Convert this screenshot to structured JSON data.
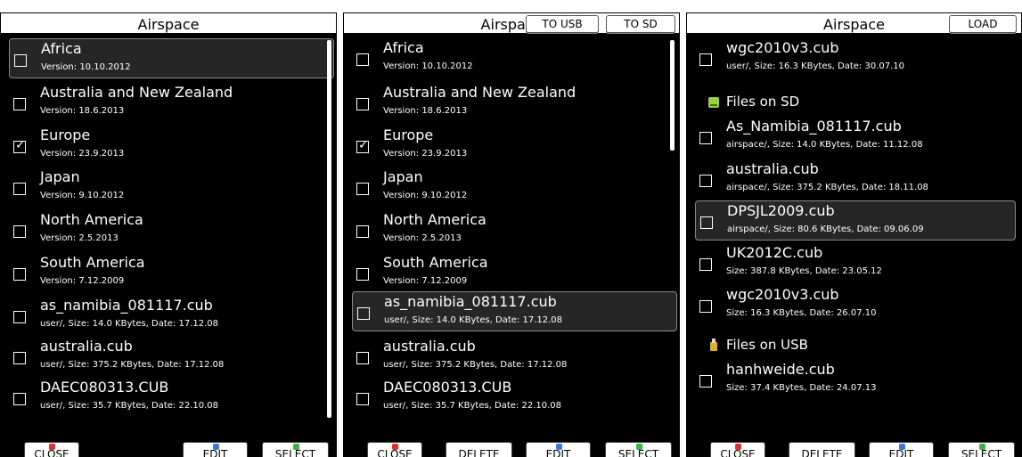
{
  "panels": [
    {
      "title": "Airspace",
      "rows": [
        {
          "name": "Africa",
          "meta": "Version: 10.10.2012",
          "checked": false
        },
        {
          "name": "Australia and New Zealand",
          "meta": "Version: 18.6.2013",
          "checked": false
        },
        {
          "name": "Europe",
          "meta": "Version: 23.9.2013",
          "checked": true
        },
        {
          "name": "Japan",
          "meta": "Version: 9.10.2012",
          "checked": false
        },
        {
          "name": "North America",
          "meta": "Version: 2.5.2013",
          "checked": false
        },
        {
          "name": "South America",
          "meta": "Version: 7.12.2009",
          "checked": false
        },
        {
          "name": "as_namibia_081117.cub",
          "meta": "user/, Size: 14.0 KBytes, Date: 17.12.08",
          "checked": false
        },
        {
          "name": "australia.cub",
          "meta": "user/, Size: 375.2 KBytes, Date: 17.12.08",
          "checked": false
        },
        {
          "name": "DAEC080313.CUB",
          "meta": "user/, Size: 35.7 KBytes, Date: 22.10.08",
          "checked": false
        }
      ],
      "buttons": {
        "close": "CLOSE",
        "edit": "EDIT",
        "select": "SELECT"
      }
    },
    {
      "title": "Airspace",
      "top_buttons": {
        "to_usb": "TO USB",
        "to_sd": "TO SD"
      },
      "rows": [
        {
          "name": "Africa",
          "meta": "Version: 10.10.2012",
          "checked": false
        },
        {
          "name": "Australia and New Zealand",
          "meta": "Version: 18.6.2013",
          "checked": false
        },
        {
          "name": "Europe",
          "meta": "Version: 23.9.2013",
          "checked": true
        },
        {
          "name": "Japan",
          "meta": "Version: 9.10.2012",
          "checked": false
        },
        {
          "name": "North America",
          "meta": "Version: 2.5.2013",
          "checked": false
        },
        {
          "name": "South America",
          "meta": "Version: 7.12.2009",
          "checked": false
        },
        {
          "name": "as_namibia_081117.cub",
          "meta": "user/, Size: 14.0 KBytes, Date: 17.12.08",
          "checked": false
        },
        {
          "name": "australia.cub",
          "meta": "user/, Size: 375.2 KBytes, Date: 17.12.08",
          "checked": false
        },
        {
          "name": "DAEC080313.CUB",
          "meta": "user/, Size: 35.7 KBytes, Date: 22.10.08",
          "checked": false
        }
      ],
      "buttons": {
        "close": "CLOSE",
        "delete": "DELETE",
        "edit": "EDIT",
        "select": "SELECT"
      }
    },
    {
      "title": "Airspace",
      "top_buttons": {
        "load": "LOAD"
      },
      "rows": [
        {
          "name": "wgc2010v3.cub",
          "meta": "user/, Size: 16.3 KBytes, Date: 30.07.10",
          "checked": false
        }
      ],
      "sd_section": "Files on SD",
      "sd_rows": [
        {
          "name": "As_Namibia_081117.cub",
          "meta": "airspace/, Size: 14.0 KBytes, Date: 11.12.08",
          "checked": false
        },
        {
          "name": "australia.cub",
          "meta": "airspace/, Size: 375.2 KBytes, Date: 18.11.08",
          "checked": false
        },
        {
          "name": "DPSJL2009.cub",
          "meta": "airspace/, Size: 80.6 KBytes, Date: 09.06.09",
          "checked": false
        },
        {
          "name": "UK2012C.cub",
          "meta": "Size: 387.8 KBytes, Date: 23.05.12",
          "checked": false
        },
        {
          "name": "wgc2010v3.cub",
          "meta": "Size: 16.3 KBytes, Date: 26.07.10",
          "checked": false
        }
      ],
      "usb_section": "Files on USB",
      "usb_rows": [
        {
          "name": "hanhweide.cub",
          "meta": "Size: 37.4 KBytes, Date: 24.07.13",
          "checked": false
        }
      ],
      "buttons": {
        "close": "CLOSE",
        "delete": "DELETE",
        "edit": "EDIT",
        "select": "SELECT"
      }
    }
  ],
  "check_glyph": "✓",
  "colors": {
    "close_mark": "#e03030",
    "edit_mark": "#3a78e0",
    "select_mark": "#3cb043",
    "sd_icon": "#9bd23c",
    "usb_icon": "#e0b020"
  }
}
